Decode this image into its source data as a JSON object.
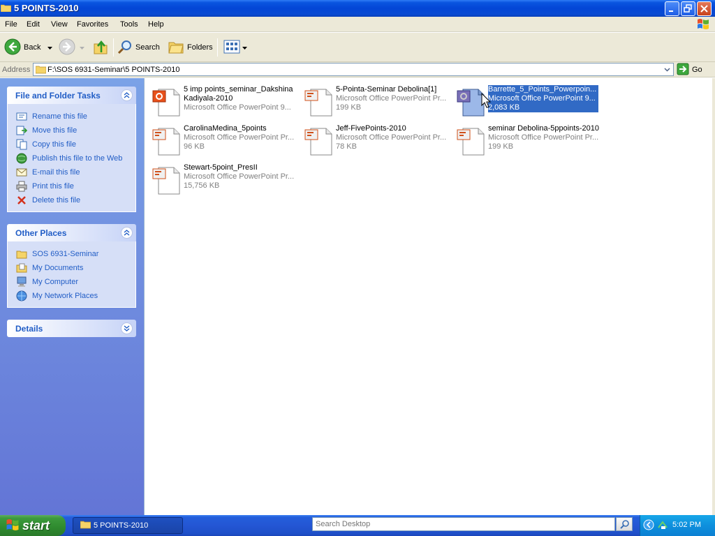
{
  "window": {
    "title": "5 POINTS-2010"
  },
  "menu": {
    "items": [
      "File",
      "Edit",
      "View",
      "Favorites",
      "Tools",
      "Help"
    ]
  },
  "toolbar": {
    "back_label": "Back",
    "search_label": "Search",
    "folders_label": "Folders"
  },
  "address": {
    "label": "Address",
    "path": "F:\\SOS 6931-Seminar\\5 POINTS-2010",
    "go_label": "Go"
  },
  "left_pane": {
    "file_tasks": {
      "title": "File and Folder Tasks",
      "items": [
        {
          "label": "Rename this file",
          "icon": "rename-icon"
        },
        {
          "label": "Move this file",
          "icon": "move-icon"
        },
        {
          "label": "Copy this file",
          "icon": "copy-icon"
        },
        {
          "label": "Publish this file to the Web",
          "icon": "publish-web-icon"
        },
        {
          "label": "E-mail this file",
          "icon": "email-icon"
        },
        {
          "label": "Print this file",
          "icon": "printer-icon"
        },
        {
          "label": "Delete this file",
          "icon": "delete-icon"
        }
      ]
    },
    "other_places": {
      "title": "Other Places",
      "items": [
        {
          "label": "SOS 6931-Seminar",
          "icon": "folder-icon"
        },
        {
          "label": "My Documents",
          "icon": "my-documents-icon"
        },
        {
          "label": "My Computer",
          "icon": "my-computer-icon"
        },
        {
          "label": "My Network Places",
          "icon": "network-places-icon"
        }
      ]
    },
    "details": {
      "title": "Details"
    }
  },
  "files": [
    {
      "name": "5 imp points_seminar_Dakshina Kadiyala-2010",
      "type": "Microsoft Office PowerPoint 9...",
      "size": ""
    },
    {
      "name": "5-Pointa-Seminar Debolina[1]",
      "type": "Microsoft Office PowerPoint Pr...",
      "size": "199 KB"
    },
    {
      "name": "Barrette_5_Points_Powerpoin...",
      "type": "Microsoft Office PowerPoint 9...",
      "size": "2,083 KB"
    },
    {
      "name": "CarolinaMedina_5points",
      "type": "Microsoft Office PowerPoint Pr...",
      "size": "96 KB"
    },
    {
      "name": "Jeff-FivePoints-2010",
      "type": "Microsoft Office PowerPoint Pr...",
      "size": "78 KB"
    },
    {
      "name": "seminar Debolina-5ppoints-2010",
      "type": "Microsoft Office PowerPoint Pr...",
      "size": "199 KB"
    },
    {
      "name": "Stewart-5point_PresII",
      "type": "Microsoft Office PowerPoint Pr...",
      "size": "15,756 KB"
    }
  ],
  "taskbar": {
    "start_label": "start",
    "task_label": "5 POINTS-2010",
    "search_placeholder": "Search Desktop",
    "clock": "5:02 PM"
  },
  "colors": {
    "title_bar": "#0346d6",
    "selection": "#316ac5",
    "task_link": "#215dc6",
    "left_pane": "#7ba2e7"
  }
}
